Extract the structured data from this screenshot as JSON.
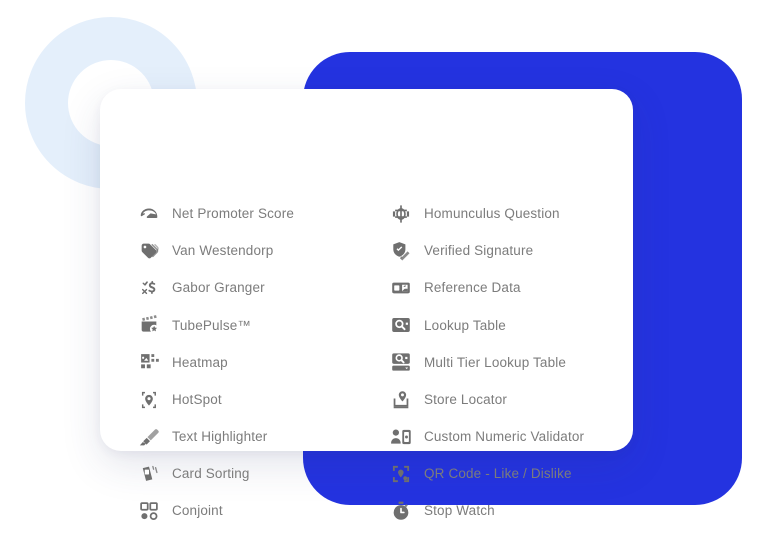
{
  "background": {
    "ring": {
      "name": "decorative-ring",
      "color": "#e4effb"
    },
    "panel": {
      "name": "blue-panel",
      "color": "#2433e0"
    },
    "card": {
      "color": "#ffffff"
    }
  },
  "theme": {
    "accent": "#2433e0",
    "ring": "#e4effb",
    "text": "#7c7c7c",
    "icon": "#6f6f6f",
    "card_bg": "#ffffff",
    "page_bg": "#ffffff"
  },
  "menu": {
    "left_column": [
      {
        "label": "Net Promoter Score",
        "icon": "speedometer-icon"
      },
      {
        "label": "Van Westendorp",
        "icon": "price-tags-icon"
      },
      {
        "label": "Gabor Granger",
        "icon": "dollar-checkmark-icon"
      },
      {
        "label": "TubePulse™",
        "icon": "video-star-icon"
      },
      {
        "label": "Heatmap",
        "icon": "heatmap-grid-icon"
      },
      {
        "label": "HotSpot",
        "icon": "hotspot-pin-icon"
      },
      {
        "label": "Text Highlighter",
        "icon": "highlighter-pen-icon"
      },
      {
        "label": "Card Sorting",
        "icon": "card-stack-icon"
      },
      {
        "label": "Conjoint",
        "icon": "conjoint-squares-icon"
      }
    ],
    "right_column": [
      {
        "label": "Homunculus Question",
        "icon": "homunculus-icon"
      },
      {
        "label": "Verified Signature",
        "icon": "verified-signature-icon"
      },
      {
        "label": "Reference Data",
        "icon": "reference-data-icon"
      },
      {
        "label": "Lookup Table",
        "icon": "lookup-table-icon"
      },
      {
        "label": "Multi Tier Lookup Table",
        "icon": "multi-tier-lookup-icon"
      },
      {
        "label": "Store Locator",
        "icon": "store-locator-icon"
      },
      {
        "label": "Custom Numeric Validator",
        "icon": "numeric-validator-icon"
      },
      {
        "label": "QR Code - Like / Dislike",
        "icon": "qr-code-icon"
      },
      {
        "label": "Stop Watch",
        "icon": "stopwatch-icon"
      }
    ]
  }
}
